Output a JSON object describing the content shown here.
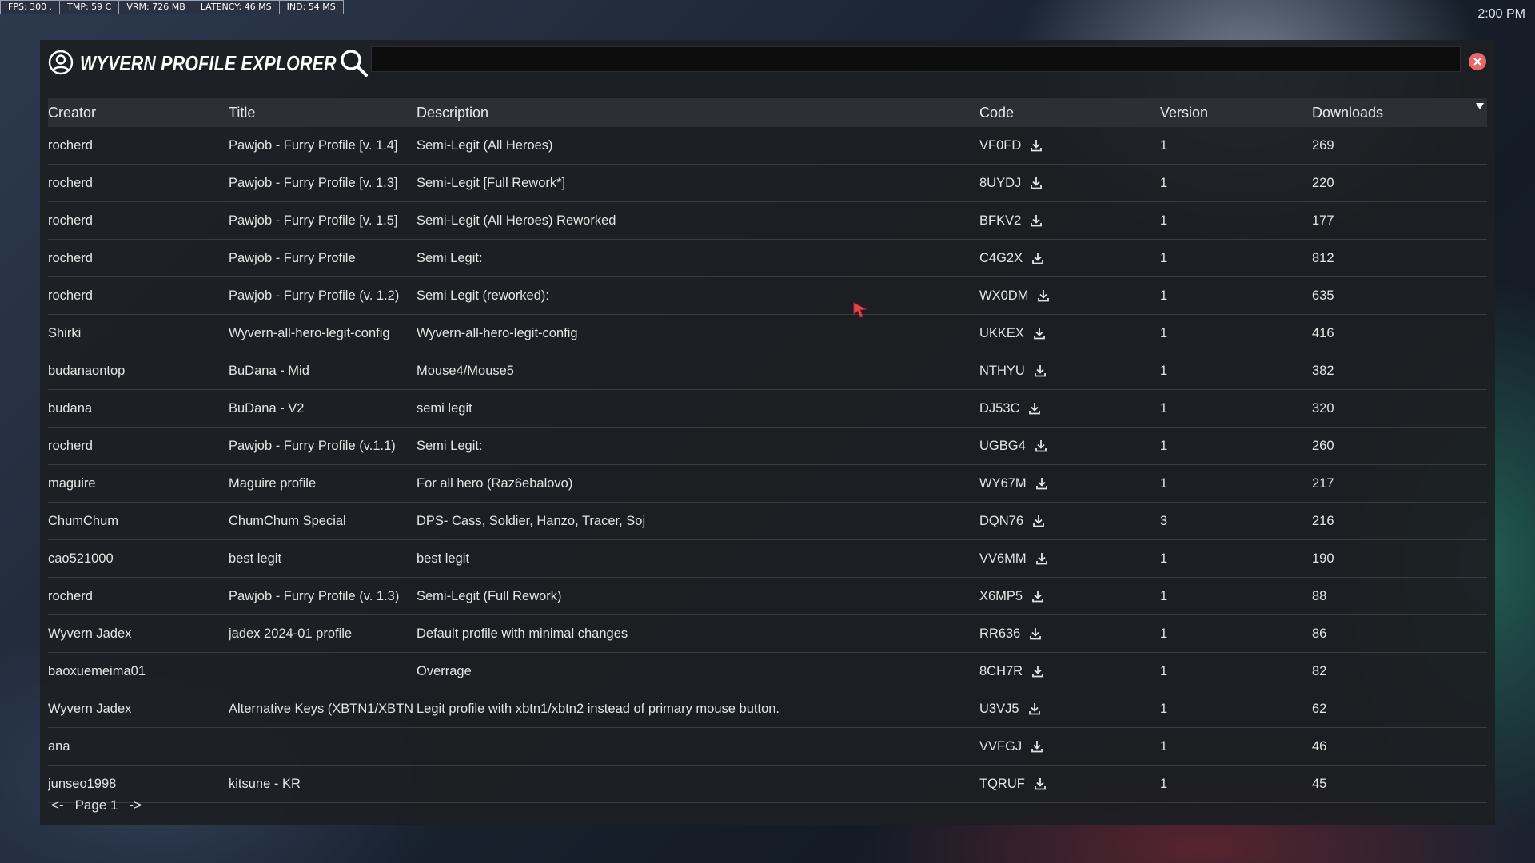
{
  "hud": {
    "fps": "FPS: 300 .",
    "tmp": "TMP: 59 C",
    "vrm": "VRM: 726 MB",
    "latency": "LATENCY: 46 MS",
    "ind": "IND: 54 MS"
  },
  "clock": "2:00 PM",
  "app": {
    "title": "WYVERN PROFILE EXPLORER",
    "search_value": "",
    "search_placeholder": ""
  },
  "table": {
    "headers": {
      "creator": "Creator",
      "title": "Title",
      "description": "Description",
      "code": "Code",
      "version": "Version",
      "downloads": "Downloads"
    },
    "rows": [
      {
        "creator": "rocherd",
        "title": "Pawjob - Furry Profile [v. 1.4]",
        "description": "Semi-Legit (All Heroes)",
        "code": "VF0FD",
        "version": "1",
        "downloads": "269"
      },
      {
        "creator": "rocherd",
        "title": "Pawjob - Furry Profile [v. 1.3]",
        "description": "Semi-Legit [Full Rework*]",
        "code": "8UYDJ",
        "version": "1",
        "downloads": "220"
      },
      {
        "creator": "rocherd",
        "title": "Pawjob - Furry Profile [v. 1.5]",
        "description": "Semi-Legit (All Heroes) Reworked",
        "code": "BFKV2",
        "version": "1",
        "downloads": "177"
      },
      {
        "creator": "rocherd",
        "title": "Pawjob - Furry Profile",
        "description": "Semi Legit:",
        "code": "C4G2X",
        "version": "1",
        "downloads": "812"
      },
      {
        "creator": "rocherd",
        "title": "Pawjob - Furry Profile (v. 1.2)",
        "description": "Semi Legit (reworked):",
        "code": "WX0DM",
        "version": "1",
        "downloads": "635"
      },
      {
        "creator": "Shirki",
        "title": "Wyvern-all-hero-legit-config",
        "description": "Wyvern-all-hero-legit-config",
        "code": "UKKEX",
        "version": "1",
        "downloads": "416"
      },
      {
        "creator": "budanaontop",
        "title": "BuDana - Mid",
        "description": "Mouse4/Mouse5",
        "code": "NTHYU",
        "version": "1",
        "downloads": "382"
      },
      {
        "creator": "budana",
        "title": "BuDana - V2",
        "description": "semi legit",
        "code": "DJ53C",
        "version": "1",
        "downloads": "320"
      },
      {
        "creator": "rocherd",
        "title": "Pawjob - Furry Profile (v.1.1)",
        "description": "Semi Legit:",
        "code": "UGBG4",
        "version": "1",
        "downloads": "260"
      },
      {
        "creator": "maguire",
        "title": "Maguire profile",
        "description": "For all hero (Raz6ebalovo)",
        "code": "WY67M",
        "version": "1",
        "downloads": "217"
      },
      {
        "creator": "ChumChum",
        "title": "ChumChum Special",
        "description": "DPS- Cass, Soldier, Hanzo, Tracer, Soj",
        "code": "DQN76",
        "version": "3",
        "downloads": "216"
      },
      {
        "creator": "cao521000",
        "title": "best legit",
        "description": "best legit",
        "code": "VV6MM",
        "version": "1",
        "downloads": "190"
      },
      {
        "creator": "rocherd",
        "title": "Pawjob - Furry Profile (v. 1.3)",
        "description": "Semi-Legit (Full Rework)",
        "code": "X6MP5",
        "version": "1",
        "downloads": "88"
      },
      {
        "creator": "Wyvern Jadex",
        "title": "jadex 2024-01 profile",
        "description": "Default profile with minimal changes",
        "code": "RR636",
        "version": "1",
        "downloads": "86"
      },
      {
        "creator": "baoxuemeima01",
        "title": "",
        "description": "Overrage",
        "code": "8CH7R",
        "version": "1",
        "downloads": "82"
      },
      {
        "creator": "Wyvern Jadex",
        "title": "Alternative Keys (XBTN1/XBTN",
        "description": "Legit profile with xbtn1/xbtn2 instead of primary mouse button.",
        "code": "U3VJ5",
        "version": "1",
        "downloads": "62"
      },
      {
        "creator": "ana",
        "title": "",
        "description": "",
        "code": "VVFGJ",
        "version": "1",
        "downloads": "46"
      },
      {
        "creator": "junseo1998",
        "title": "kitsune - KR",
        "description": "",
        "code": "TQRUF",
        "version": "1",
        "downloads": "45"
      }
    ]
  },
  "pager": {
    "prev": "<-",
    "label": "Page 1",
    "next": "->"
  },
  "colors": {
    "window_bg": "#1c1e22",
    "header_row_bg": "#2d2f34",
    "close_button": "#e8666a",
    "cursor": "#e8434b"
  },
  "icons": {
    "title_icon": "user-circle-icon",
    "search": "search-icon",
    "close": "close-icon",
    "download": "download-icon",
    "sort": "sort-desc-icon"
  }
}
